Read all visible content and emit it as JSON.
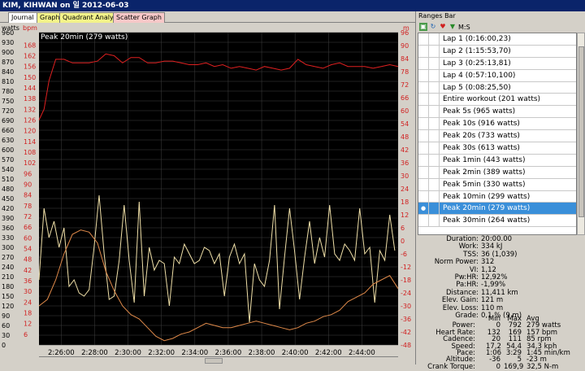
{
  "window": {
    "title": "KIM, KIHWAN on 일 2012-06-03"
  },
  "tabs": [
    {
      "label": "Journal",
      "color": "#ffffff"
    },
    {
      "label": "Graph",
      "color": "#f3f38a"
    },
    {
      "label": "Quadrant Analysis",
      "color": "#f3f38a"
    },
    {
      "label": "Scatter Graph",
      "color": "#f7c8c8"
    }
  ],
  "chart": {
    "left_axis_unit": "watts",
    "middle_axis_unit": "bpm",
    "right_axis_unit": "m",
    "peak_label": "Peak 20min (279 watts)",
    "colors": {
      "background": "#000000",
      "hr": "#e02020",
      "power": "#f0e0a8",
      "altitude": "#e08a4a",
      "grid": "#404040"
    }
  },
  "chart_data": {
    "type": "line",
    "xlabel": "",
    "ylabel": "",
    "x_ticks": [
      "2:26:00",
      "2:28:00",
      "2:30:00",
      "2:32:00",
      "2:34:00",
      "2:36:00",
      "2:38:00",
      "2:40:00",
      "2:42:00",
      "2:44:00"
    ],
    "x_range": [
      "2:24:40",
      "2:46:10"
    ],
    "watts_ticks": [
      960,
      930,
      900,
      870,
      840,
      810,
      780,
      750,
      720,
      690,
      660,
      630,
      600,
      570,
      540,
      510,
      480,
      450,
      420,
      390,
      360,
      330,
      300,
      270,
      240,
      210,
      180,
      150,
      120,
      90,
      60,
      30,
      0
    ],
    "bpm_ticks": [
      168,
      162,
      156,
      150,
      144,
      138,
      132,
      126,
      120,
      114,
      108,
      102,
      96,
      90,
      84,
      78,
      72,
      66,
      60,
      54,
      48,
      42,
      36,
      30,
      24,
      18,
      12,
      6
    ],
    "m_ticks": [
      96,
      90,
      84,
      78,
      72,
      66,
      60,
      54,
      48,
      42,
      36,
      30,
      24,
      18,
      12,
      6,
      0,
      -6,
      -12,
      -18,
      -24,
      -30,
      -36,
      -42,
      -48
    ],
    "watts_range": [
      0,
      960
    ],
    "m_range": [
      -48,
      96
    ],
    "series": [
      {
        "axis": "bpm",
        "x": [
          0,
          0.3,
          0.6,
          1,
          1.5,
          2,
          2.5,
          3,
          3.5,
          4,
          4.5,
          5,
          5.5,
          6,
          6.5,
          7,
          7.5,
          8,
          8.5,
          9,
          9.5,
          10,
          10.5,
          11,
          11.5,
          12,
          12.5,
          13,
          13.5,
          14,
          14.5,
          15,
          15.5,
          16,
          16.5,
          17,
          17.5,
          18,
          18.5,
          19,
          19.5,
          20,
          20.5,
          21,
          21.5
        ],
        "values": [
          126,
          132,
          148,
          160,
          160,
          158,
          158,
          158,
          159,
          163,
          162,
          158,
          161,
          161,
          158,
          158,
          159,
          159,
          158,
          157,
          157,
          158,
          156,
          157,
          155,
          156,
          155,
          154,
          156,
          155,
          154,
          155,
          160,
          157,
          156,
          155,
          157,
          158,
          156,
          156,
          156,
          155,
          156,
          157,
          156
        ]
      },
      {
        "axis": "watts",
        "x": [
          0,
          0.3,
          0.6,
          0.9,
          1.2,
          1.5,
          1.8,
          2.1,
          2.4,
          2.7,
          3,
          3.3,
          3.6,
          3.9,
          4.2,
          4.5,
          4.8,
          5.1,
          5.4,
          5.7,
          6,
          6.3,
          6.6,
          6.9,
          7.2,
          7.5,
          7.8,
          8.1,
          8.4,
          8.7,
          9,
          9.3,
          9.6,
          9.9,
          10.2,
          10.5,
          10.8,
          11.1,
          11.4,
          11.7,
          12,
          12.3,
          12.6,
          12.9,
          13.2,
          13.5,
          13.8,
          14.1,
          14.4,
          14.7,
          15,
          15.3,
          15.6,
          15.9,
          16.2,
          16.5,
          16.8,
          17.1,
          17.4,
          17.7,
          18,
          18.3,
          18.6,
          18.9,
          19.2,
          19.5,
          19.8,
          20.1,
          20.4,
          20.7,
          21,
          21.3
        ],
        "values": [
          200,
          420,
          330,
          380,
          300,
          360,
          180,
          200,
          160,
          150,
          170,
          300,
          460,
          280,
          140,
          150,
          260,
          430,
          260,
          130,
          440,
          150,
          300,
          230,
          260,
          250,
          120,
          270,
          250,
          310,
          280,
          250,
          260,
          300,
          290,
          250,
          280,
          150,
          270,
          310,
          250,
          280,
          70,
          250,
          200,
          180,
          260,
          430,
          110,
          270,
          420,
          290,
          140,
          270,
          380,
          250,
          330,
          270,
          430,
          280,
          260,
          310,
          290,
          260,
          420,
          280,
          300,
          130,
          290,
          260,
          400,
          290
        ]
      },
      {
        "axis": "m",
        "x": [
          0,
          0.5,
          1,
          1.5,
          2,
          2.5,
          3,
          3.5,
          4,
          4.5,
          5,
          5.5,
          6,
          6.5,
          7,
          7.5,
          8,
          8.5,
          9,
          9.5,
          10,
          10.5,
          11,
          11.5,
          12,
          12.5,
          13,
          13.5,
          14,
          14.5,
          15,
          15.5,
          16,
          16.5,
          17,
          17.5,
          18,
          18.5,
          19,
          19.5,
          20,
          20.5,
          21,
          21.5
        ],
        "values": [
          -30,
          -27,
          -18,
          -6,
          3,
          5,
          4,
          -1,
          -14,
          -23,
          -30,
          -34,
          -36,
          -40,
          -44,
          -46,
          -45,
          -43,
          -42,
          -40,
          -38,
          -39,
          -40,
          -40,
          -39,
          -38,
          -37,
          -38,
          -39,
          -40,
          -41,
          -40,
          -38,
          -37,
          -35,
          -34,
          -32,
          -28,
          -26,
          -24,
          -20,
          -18,
          -16,
          -22
        ]
      }
    ]
  },
  "ranges": {
    "title": "Ranges Bar",
    "toolbar_text": "M:S",
    "items": [
      {
        "label": "Lap 1 (0:16:00,23)",
        "selected": false
      },
      {
        "label": "Lap 2 (1:15:53,70)",
        "selected": false
      },
      {
        "label": "Lap 3 (0:25:13,81)",
        "selected": false
      },
      {
        "label": "Lap 4 (0:57:10,100)",
        "selected": false
      },
      {
        "label": "Lap 5 (0:08:25,50)",
        "selected": false
      },
      {
        "label": "Entire workout (201 watts)",
        "selected": false
      },
      {
        "label": "Peak 5s (965 watts)",
        "selected": false
      },
      {
        "label": "Peak 10s (916 watts)",
        "selected": false
      },
      {
        "label": "Peak 20s (733 watts)",
        "selected": false
      },
      {
        "label": "Peak 30s (613 watts)",
        "selected": false
      },
      {
        "label": "Peak 1min (443 watts)",
        "selected": false
      },
      {
        "label": "Peak 2min (389 watts)",
        "selected": false
      },
      {
        "label": "Peak 5min (330 watts)",
        "selected": false
      },
      {
        "label": "Peak 10min (299 watts)",
        "selected": false
      },
      {
        "label": "Peak 20min (279 watts)",
        "selected": true
      },
      {
        "label": "Peak 30min (264 watts)",
        "selected": false
      }
    ]
  },
  "stats": [
    {
      "k": "Duration:",
      "v": "20:00.00"
    },
    {
      "k": "Work:",
      "v": "334 kJ"
    },
    {
      "k": "TSS:",
      "v": "36 (1,039)"
    },
    {
      "k": "Norm Power:",
      "v": "312"
    },
    {
      "k": "VI:",
      "v": "1,12"
    },
    {
      "k": "Pw:HR:",
      "v": "12,92%"
    },
    {
      "k": "Pa:HR:",
      "v": "-1,99%"
    },
    {
      "k": "Distance:",
      "v": "11,411 km"
    },
    {
      "k": "Elev. Gain:",
      "v": "121 m"
    },
    {
      "k": "Elev. Loss:",
      "v": "110 m"
    },
    {
      "k": "Grade:",
      "v": "0,1 %  (9 m)"
    }
  ],
  "mma": {
    "headers": {
      "min": "Min",
      "max": "Max",
      "avg": "Avg"
    },
    "rows": [
      {
        "k": "Power:",
        "min": "0",
        "max": "792",
        "avg": "279 watts"
      },
      {
        "k": "Heart Rate:",
        "min": "132",
        "max": "169",
        "avg": "157 bpm"
      },
      {
        "k": "Cadence:",
        "min": "20",
        "max": "111",
        "avg": "85 rpm"
      },
      {
        "k": "Speed:",
        "min": "17,2",
        "max": "54,4",
        "avg": "34,3 kph"
      },
      {
        "k": "Pace:",
        "min": "1:06",
        "max": "3:29",
        "avg": "1:45 min/km"
      },
      {
        "k": "Altitude:",
        "min": "-36",
        "max": "5",
        "avg": "-23 m"
      },
      {
        "k": "Crank Torque:",
        "min": "0",
        "max": "169,9",
        "avg": "32,5 N-m"
      }
    ]
  }
}
